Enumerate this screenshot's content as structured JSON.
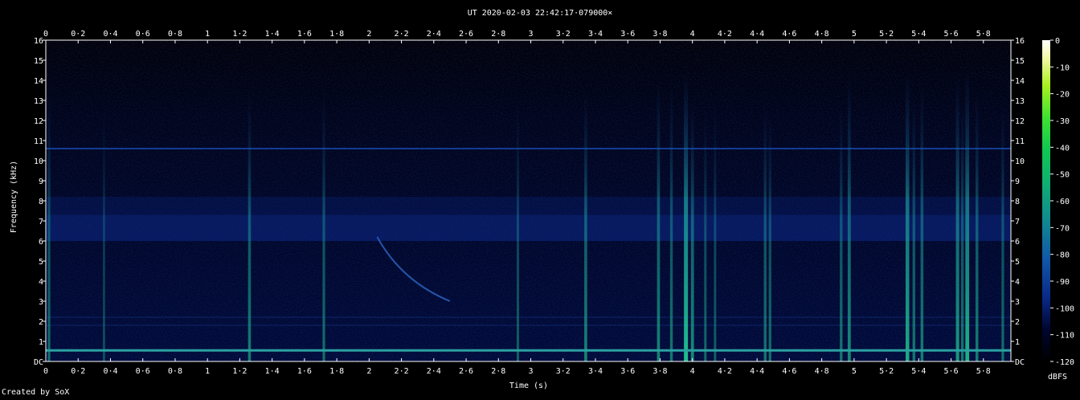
{
  "chart_data": {
    "type": "heatmap",
    "title": "UT 2020-02-03 22:42:17·079000×",
    "xlabel": "Time (s)",
    "ylabel": "Frequency (kHz)",
    "xlim": [
      0,
      5.97
    ],
    "ylim": [
      0,
      16
    ],
    "x_ticks": [
      "0",
      "0·2",
      "0·4",
      "0·6",
      "0·8",
      "1",
      "1·2",
      "1·4",
      "1·6",
      "1·8",
      "2",
      "2·2",
      "2·4",
      "2·6",
      "2·8",
      "3",
      "3·2",
      "3·4",
      "3·6",
      "3·8",
      "4",
      "4·2",
      "4·4",
      "4·6",
      "4·8",
      "5",
      "5·2",
      "5·4",
      "5·6",
      "5·8"
    ],
    "x_tick_values": [
      0,
      0.2,
      0.4,
      0.6,
      0.8,
      1,
      1.2,
      1.4,
      1.6,
      1.8,
      2,
      2.2,
      2.4,
      2.6,
      2.8,
      3,
      3.2,
      3.4,
      3.6,
      3.8,
      4,
      4.2,
      4.4,
      4.6,
      4.8,
      5,
      5.2,
      5.4,
      5.6,
      5.8
    ],
    "y_ticks": [
      "DC",
      "1",
      "2",
      "3",
      "4",
      "5",
      "6",
      "7",
      "8",
      "9",
      "10",
      "11",
      "12",
      "13",
      "14",
      "15",
      "16"
    ],
    "y_tick_values": [
      0,
      1,
      2,
      3,
      4,
      5,
      6,
      7,
      8,
      9,
      10,
      11,
      12,
      13,
      14,
      15,
      16
    ],
    "colorbar": {
      "label": "dBFS",
      "range": [
        -120,
        0
      ],
      "ticks": [
        "0",
        "-10",
        "-20",
        "-30",
        "-40",
        "-50",
        "-60",
        "-70",
        "-80",
        "-90",
        "-100",
        "-110",
        "-120"
      ],
      "tick_values": [
        0,
        -10,
        -20,
        -30,
        -40,
        -50,
        -60,
        -70,
        -80,
        -90,
        -100,
        -110,
        -120
      ]
    },
    "background_band": {
      "fmin": 6.0,
      "fmax": 7.3
    },
    "hum_line": {
      "f": 0.55
    },
    "tone_line": {
      "f": 10.6
    },
    "sweep": {
      "t_start": 2.05,
      "f_start": 6.2,
      "t_end": 2.5,
      "f_end": 3.0
    },
    "vertical_events": [
      {
        "t": 0.02,
        "fmax": 13.5,
        "strength": 0.4
      },
      {
        "t": 0.36,
        "fmax": 12.8,
        "strength": 0.2
      },
      {
        "t": 1.26,
        "fmax": 13.5,
        "strength": 0.5
      },
      {
        "t": 1.72,
        "fmax": 13.6,
        "strength": 0.4
      },
      {
        "t": 2.92,
        "fmax": 13.0,
        "strength": 0.3
      },
      {
        "t": 3.34,
        "fmax": 13.6,
        "strength": 0.55
      },
      {
        "t": 3.79,
        "fmax": 14.2,
        "strength": 0.55
      },
      {
        "t": 3.87,
        "fmax": 13.8,
        "strength": 0.45
      },
      {
        "t": 3.96,
        "fmax": 14.4,
        "strength": 1.0
      },
      {
        "t": 4.0,
        "fmax": 13.0,
        "strength": 0.6
      },
      {
        "t": 4.08,
        "fmax": 12.6,
        "strength": 0.35
      },
      {
        "t": 4.14,
        "fmax": 12.8,
        "strength": 0.3
      },
      {
        "t": 4.45,
        "fmax": 13.0,
        "strength": 0.45
      },
      {
        "t": 4.48,
        "fmax": 12.5,
        "strength": 0.4
      },
      {
        "t": 4.92,
        "fmax": 12.8,
        "strength": 0.45
      },
      {
        "t": 4.97,
        "fmax": 14.3,
        "strength": 0.6
      },
      {
        "t": 5.33,
        "fmax": 14.4,
        "strength": 0.85
      },
      {
        "t": 5.37,
        "fmax": 13.3,
        "strength": 0.45
      },
      {
        "t": 5.42,
        "fmax": 14.0,
        "strength": 0.5
      },
      {
        "t": 5.64,
        "fmax": 14.2,
        "strength": 0.7
      },
      {
        "t": 5.67,
        "fmax": 13.0,
        "strength": 0.45
      },
      {
        "t": 5.7,
        "fmax": 14.5,
        "strength": 0.9
      },
      {
        "t": 5.76,
        "fmax": 13.5,
        "strength": 0.5
      },
      {
        "t": 5.92,
        "fmax": 13.0,
        "strength": 0.4
      }
    ],
    "grid": false
  },
  "footer": {
    "credit": "Created by SoX"
  }
}
